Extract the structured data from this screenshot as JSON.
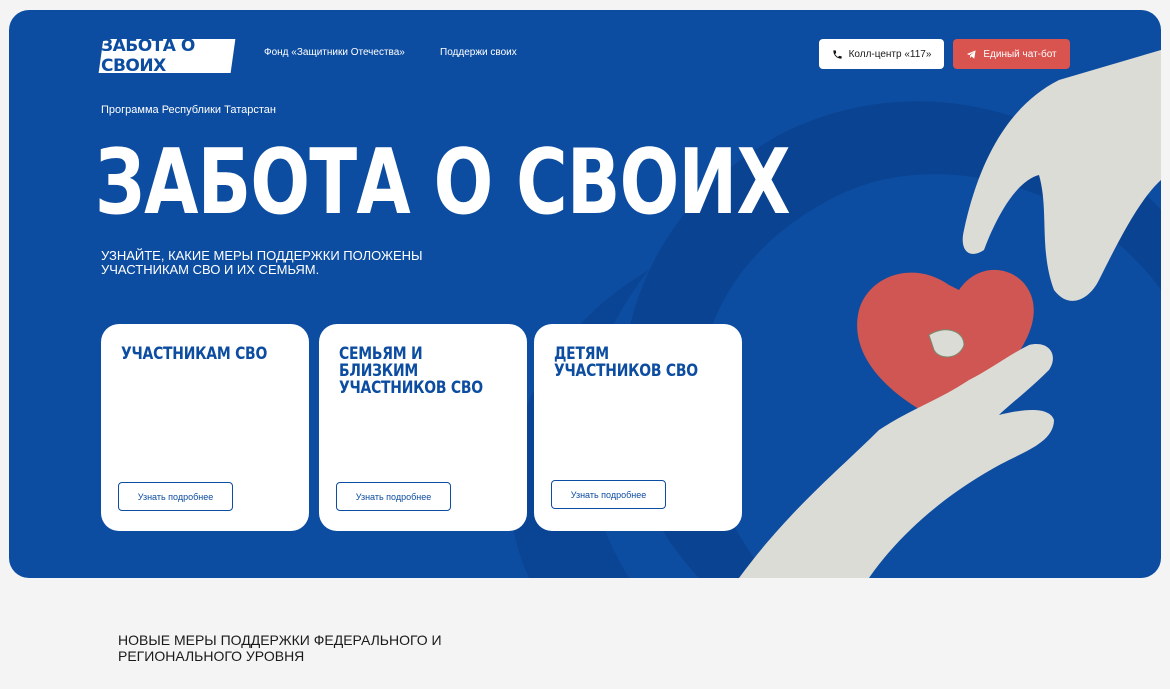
{
  "header": {
    "logo_text": "ЗАБОТА О СВОИХ",
    "nav": [
      {
        "label": "Фонд «Защитники Отечества»"
      },
      {
        "label": "Поддержи своих"
      }
    ],
    "call_center_label": "Колл-центр «117»",
    "chatbot_label": "Единый чат-бот"
  },
  "hero": {
    "program": "Программа Республики Татарстан",
    "title": "ЗАБОТА О СВОИХ",
    "subtitle": "УЗНАЙТЕ, КАКИЕ МЕРЫ ПОДДЕРЖКИ ПОЛОЖЕНЫ УЧАСТНИКАМ СВО И ИХ СЕМЬЯМ."
  },
  "cards": [
    {
      "title": "УЧАСТНИКАМ СВО",
      "button": "Узнать подробнее"
    },
    {
      "title": "СЕМЬЯМ И БЛИЗКИМ УЧАСТНИКОВ СВО",
      "button": "Узнать подробнее"
    },
    {
      "title": "ДЕТЯМ УЧАСТНИКОВ СВО",
      "button": "Узнать подробнее"
    }
  ],
  "section": {
    "title": "НОВЫЕ МЕРЫ ПОДДЕРЖКИ ФЕДЕРАЛЬНОГО И РЕГИОНАЛЬНОГО УРОВНЯ"
  },
  "colors": {
    "brand_blue": "#0d4da1",
    "accent_red": "#d9534f",
    "heart_red": "#cf5652",
    "hand_gray": "#dcdcd6"
  },
  "icons": {
    "call": "phone-icon",
    "chat": "telegram-icon"
  }
}
